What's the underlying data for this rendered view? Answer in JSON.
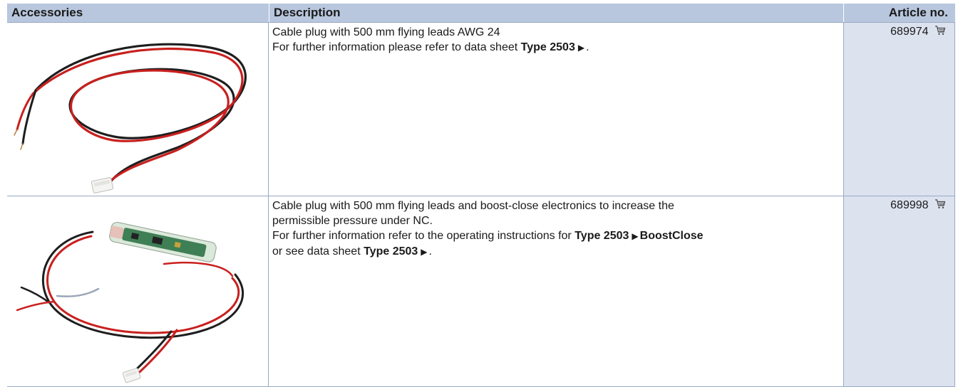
{
  "header": {
    "accessories": "Accessories",
    "description": "Description",
    "article_no": "Article no."
  },
  "rows": [
    {
      "image_icon": "cable-plug-flying-leads-image",
      "line1": "Cable plug with 500 mm flying leads AWG 24",
      "line2_pre": "For further information please refer to data sheet",
      "line2_link": "Type 2503",
      "line2_post": ".",
      "article": "689974",
      "cart_icon": "shopping-cart-icon"
    },
    {
      "image_icon": "cable-plug-boost-close-electronics-image",
      "line1": "Cable plug with 500 mm flying leads and boost-close electronics to increase the",
      "line2": "permissible pressure under NC.",
      "line3_pre": "For further information refer to the operating instructions for",
      "line3_link1": "Type 2503",
      "line3_link2": "BoostClose",
      "line4_pre": "or see data sheet",
      "line4_link": "Type 2503",
      "line4_post": ".",
      "article": "689998",
      "cart_icon": "shopping-cart-icon"
    }
  ],
  "link_marker": "▶",
  "colors": {
    "header_bg": "#b8c7de",
    "article_col_bg": "#dce3ef",
    "rule": "#98a9c4",
    "wire_red": "#c8201e",
    "wire_black": "#1e1e1e"
  }
}
